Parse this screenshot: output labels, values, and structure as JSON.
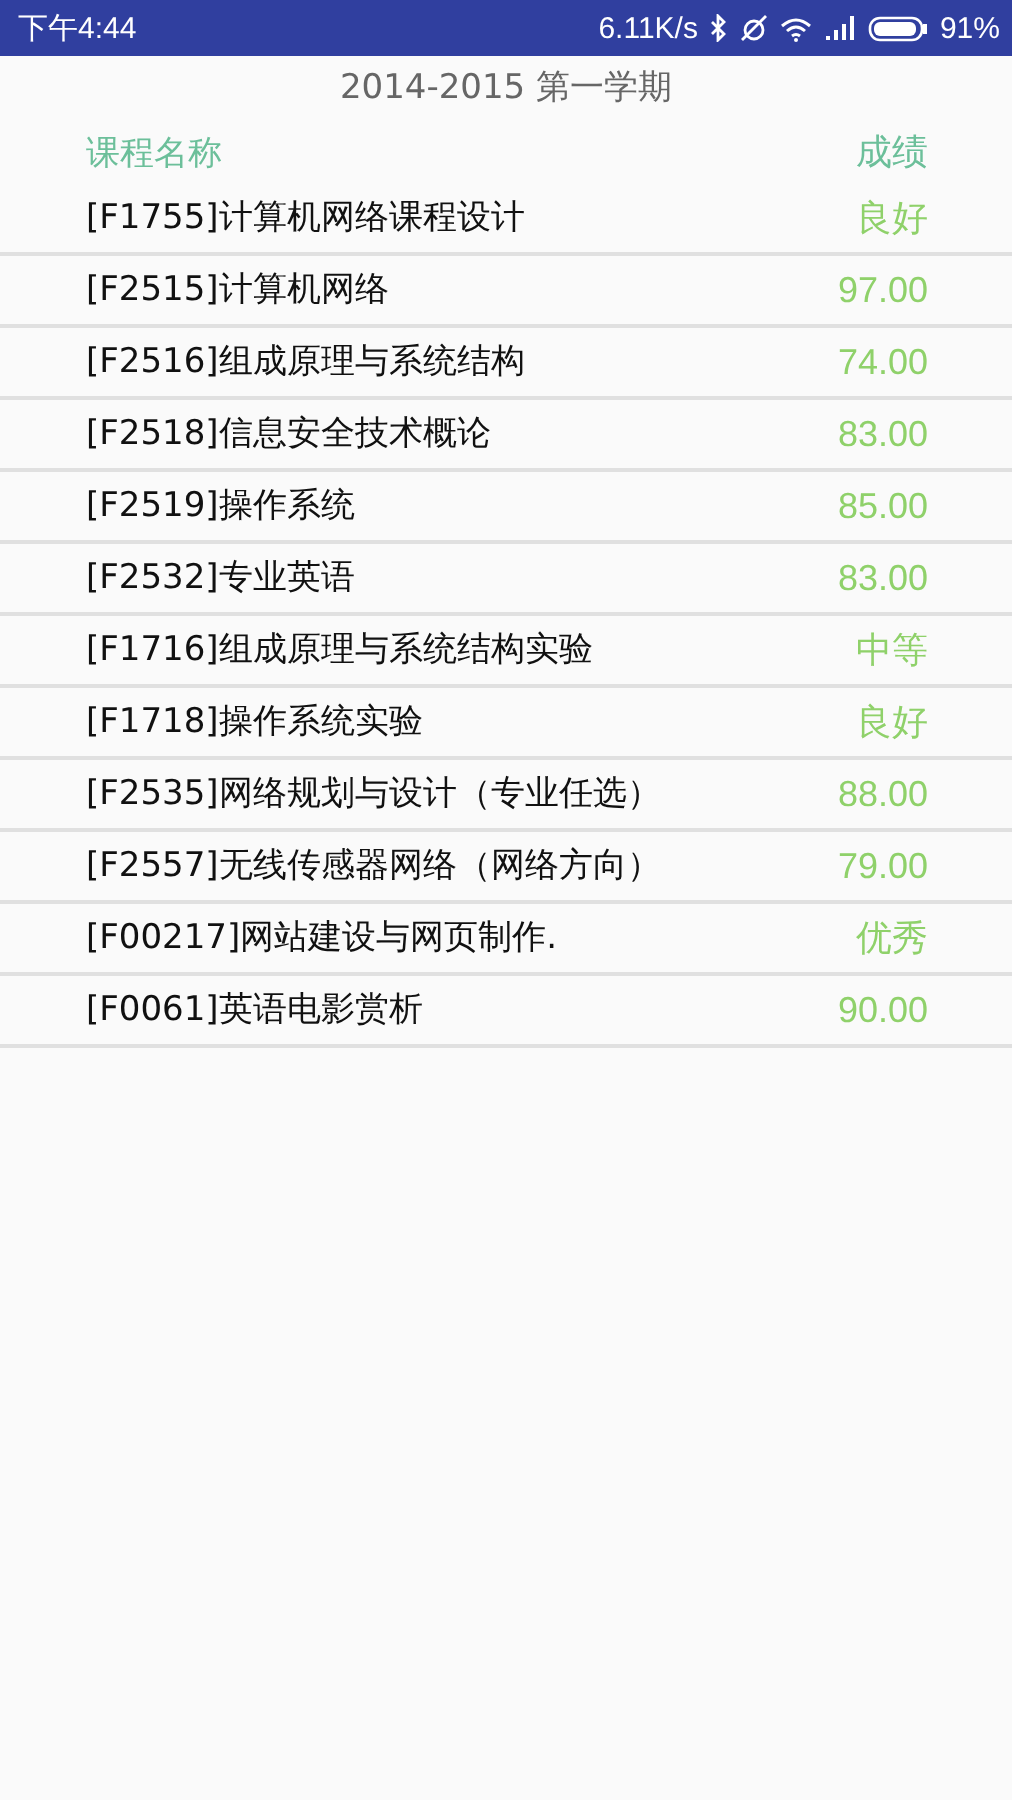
{
  "status_bar": {
    "time": "下午4:44",
    "speed": "6.11K/s",
    "battery": "91%"
  },
  "title": "2014-2015 第一学期",
  "header": {
    "name": "课程名称",
    "grade": "成绩"
  },
  "rows": [
    {
      "name": "[F1755]计算机网络课程设计",
      "grade": "良好"
    },
    {
      "name": "[F2515]计算机网络",
      "grade": "97.00"
    },
    {
      "name": "[F2516]组成原理与系统结构",
      "grade": "74.00"
    },
    {
      "name": "[F2518]信息安全技术概论",
      "grade": "83.00"
    },
    {
      "name": "[F2519]操作系统",
      "grade": "85.00"
    },
    {
      "name": "[F2532]专业英语",
      "grade": "83.00"
    },
    {
      "name": "[F1716]组成原理与系统结构实验",
      "grade": "中等"
    },
    {
      "name": "[F1718]操作系统实验",
      "grade": "良好"
    },
    {
      "name": "[F2535]网络规划与设计（专业任选）",
      "grade": "88.00"
    },
    {
      "name": "[F2557]无线传感器网络（网络方向）",
      "grade": "79.00"
    },
    {
      "name": "[F00217]网站建设与网页制作.",
      "grade": "优秀"
    },
    {
      "name": "[F0061]英语电影赏析",
      "grade": "90.00"
    }
  ]
}
